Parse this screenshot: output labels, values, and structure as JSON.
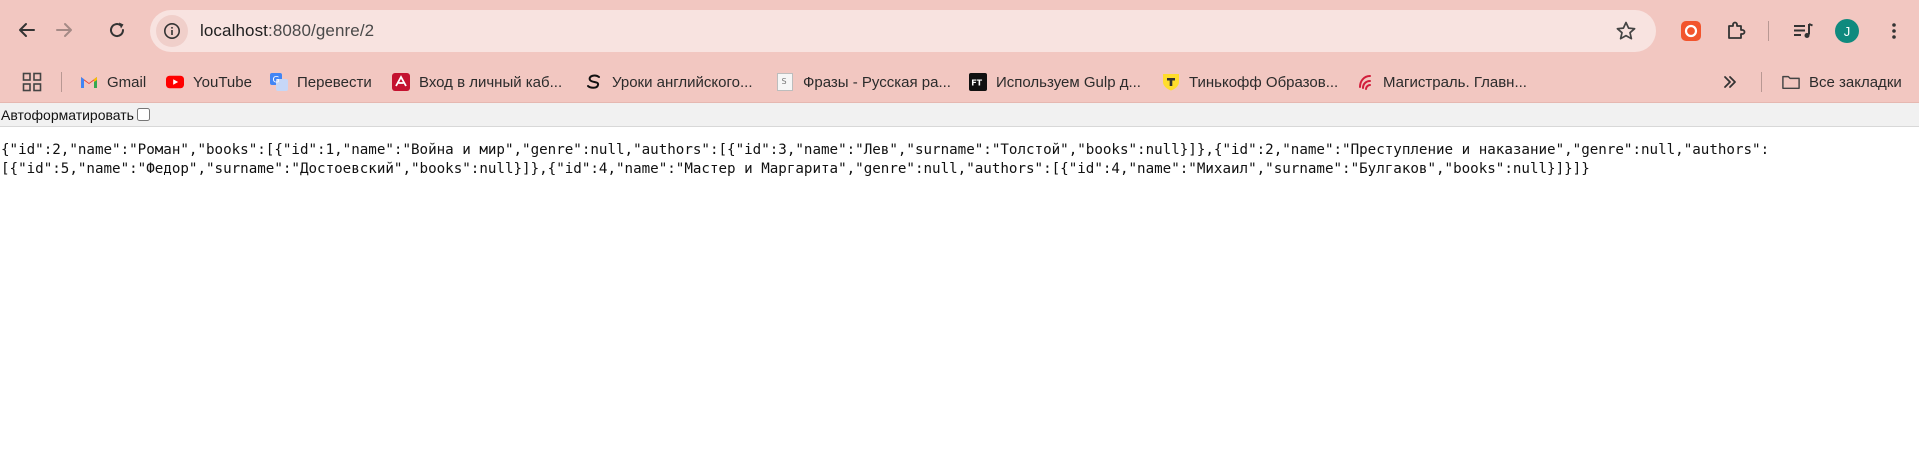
{
  "browser": {
    "url_host": "localhost",
    "url_path": ":8080/genre/2",
    "profile_initial": "J",
    "avatar_color": "#0f8a7e",
    "frame_color": "#f2c7c1"
  },
  "bookmarks": [
    {
      "label": "Gmail",
      "icon": "gmail-icon"
    },
    {
      "label": "YouTube",
      "icon": "youtube-icon"
    },
    {
      "label": "Перевести",
      "icon": "google-translate-icon"
    },
    {
      "label": "Вход в личный каб...",
      "icon": "red-logo-icon"
    },
    {
      "label": "Уроки английского...",
      "icon": "s-swirl-icon"
    },
    {
      "label": "Фразы - Русская ра...",
      "icon": "page-s-icon"
    },
    {
      "label": "Используем Gulp д...",
      "icon": "ft-icon"
    },
    {
      "label": "Тинькофф Образов...",
      "icon": "tinkoff-icon"
    },
    {
      "label": "Магистраль. Главн...",
      "icon": "magistral-icon"
    }
  ],
  "all_bookmarks_label": "Все закладки",
  "page": {
    "autoformat_label": "Автоформатировать",
    "autoformat_checked": false,
    "json_line1": "{\"id\":2,\"name\":\"Роман\",\"books\":[{\"id\":1,\"name\":\"Война и мир\",\"genre\":null,\"authors\":[{\"id\":3,\"name\":\"Лев\",\"surname\":\"Толстой\",\"books\":null}]},{\"id\":2,\"name\":\"Преступление и наказание\",\"genre\":null,\"authors\":",
    "json_line2": "[{\"id\":5,\"name\":\"Федор\",\"surname\":\"Достоевский\",\"books\":null}]},{\"id\":4,\"name\":\"Мастер и Маргарита\",\"genre\":null,\"authors\":[{\"id\":4,\"name\":\"Михаил\",\"surname\":\"Булгаков\",\"books\":null}]}]}"
  }
}
